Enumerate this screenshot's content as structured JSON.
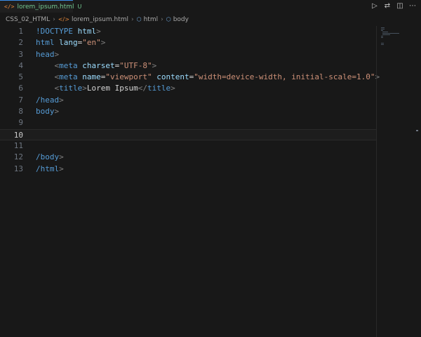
{
  "tab": {
    "file_icon": "</>",
    "title": "lorem_ipsum.html",
    "status": "U"
  },
  "actions": [
    {
      "name": "run-icon",
      "glyph": "▷"
    },
    {
      "name": "compare-changes-icon",
      "glyph": "⇄"
    },
    {
      "name": "split-editor-icon",
      "glyph": "◫"
    },
    {
      "name": "more-actions-icon",
      "glyph": "⋯"
    }
  ],
  "breadcrumb": {
    "folder": "CSS_02_HTML",
    "file_icon": "</>",
    "file": "lorem_ipsum.html",
    "symbol1_icon": "⬡",
    "symbol1": "html",
    "symbol2_icon": "⬡",
    "symbol2": "body"
  },
  "editor": {
    "current_line": 10,
    "lines": [
      {
        "n": "1",
        "parts": [
          {
            "c": "tag",
            "t": "!DOCTYPE "
          },
          {
            "c": "attr",
            "t": "html"
          },
          {
            "c": "punc",
            "t": ">"
          }
        ]
      },
      {
        "n": "2",
        "parts": [
          {
            "c": "tag",
            "t": "html "
          },
          {
            "c": "attr",
            "t": "lang"
          },
          {
            "c": "txt",
            "t": "="
          },
          {
            "c": "val",
            "t": "\"en\""
          },
          {
            "c": "punc",
            "t": ">"
          }
        ]
      },
      {
        "n": "3",
        "parts": [
          {
            "c": "tag",
            "t": "head"
          },
          {
            "c": "punc",
            "t": ">"
          }
        ]
      },
      {
        "n": "4",
        "parts": [
          {
            "c": "txt",
            "t": "    "
          },
          {
            "c": "punc",
            "t": "<"
          },
          {
            "c": "tag",
            "t": "meta "
          },
          {
            "c": "attr",
            "t": "charset"
          },
          {
            "c": "txt",
            "t": "="
          },
          {
            "c": "val",
            "t": "\"UTF-8\""
          },
          {
            "c": "punc",
            "t": ">"
          }
        ]
      },
      {
        "n": "5",
        "parts": [
          {
            "c": "txt",
            "t": "    "
          },
          {
            "c": "punc",
            "t": "<"
          },
          {
            "c": "tag",
            "t": "meta "
          },
          {
            "c": "attr",
            "t": "name"
          },
          {
            "c": "txt",
            "t": "="
          },
          {
            "c": "val",
            "t": "\"viewport\" "
          },
          {
            "c": "attr",
            "t": "content"
          },
          {
            "c": "txt",
            "t": "="
          },
          {
            "c": "val",
            "t": "\"width=device-width, initial-scale=1.0\""
          },
          {
            "c": "punc",
            "t": ">"
          }
        ]
      },
      {
        "n": "6",
        "parts": [
          {
            "c": "txt",
            "t": "    "
          },
          {
            "c": "punc",
            "t": "<"
          },
          {
            "c": "tag",
            "t": "title"
          },
          {
            "c": "punc",
            "t": ">"
          },
          {
            "c": "txt",
            "t": "Lorem Ipsum"
          },
          {
            "c": "punc",
            "t": "</"
          },
          {
            "c": "tag",
            "t": "title"
          },
          {
            "c": "punc",
            "t": ">"
          }
        ]
      },
      {
        "n": "7",
        "parts": [
          {
            "c": "tag",
            "t": "/head"
          },
          {
            "c": "punc",
            "t": ">"
          }
        ]
      },
      {
        "n": "8",
        "parts": [
          {
            "c": "tag",
            "t": "body"
          },
          {
            "c": "punc",
            "t": ">"
          }
        ]
      },
      {
        "n": "9",
        "parts": []
      },
      {
        "n": "10",
        "parts": []
      },
      {
        "n": "11",
        "parts": []
      },
      {
        "n": "12",
        "parts": [
          {
            "c": "tag",
            "t": "/body"
          },
          {
            "c": "punc",
            "t": ">"
          }
        ]
      },
      {
        "n": "13",
        "parts": [
          {
            "c": "tag",
            "t": "/html"
          },
          {
            "c": "punc",
            "t": ">"
          }
        ]
      }
    ]
  },
  "colors": {
    "background": "#181818",
    "tab_active_border": "#3b8eea",
    "untracked_green": "#73c991",
    "tag_blue": "#569cd6",
    "attr_lightblue": "#9cdcfe",
    "string_orange": "#ce9178"
  }
}
